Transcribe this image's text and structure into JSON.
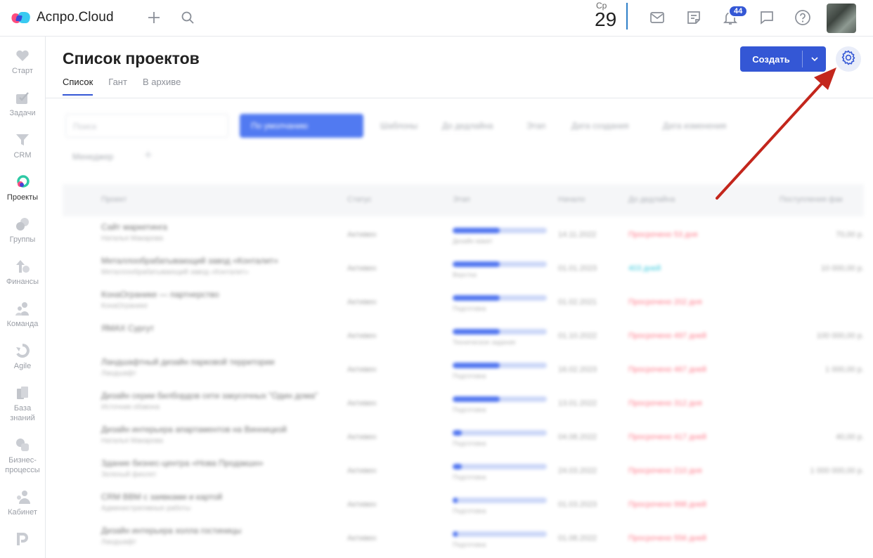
{
  "app": {
    "name": "Аспро.Cloud"
  },
  "date": {
    "weekday": "Ср",
    "day": "29"
  },
  "notifications": {
    "count": "44"
  },
  "sidebar": {
    "items": [
      {
        "label": "Старт"
      },
      {
        "label": "Задачи"
      },
      {
        "label": "CRM"
      },
      {
        "label": "Проекты"
      },
      {
        "label": "Группы"
      },
      {
        "label": "Финансы"
      },
      {
        "label": "Команда"
      },
      {
        "label": "Agile"
      },
      {
        "label": "База знаний"
      },
      {
        "label": "Бизнес-процессы"
      },
      {
        "label": "Кабинет"
      }
    ]
  },
  "page": {
    "title": "Список проектов",
    "tabs": [
      {
        "label": "Список"
      },
      {
        "label": "Гант"
      },
      {
        "label": "В архиве"
      }
    ],
    "create_label": "Создать"
  },
  "blurred": {
    "search_placeholder": "Поиск",
    "filter_label": "По умолчанию",
    "chips": [
      "Шаблоны",
      "До дедлайна",
      "Этап",
      "Дата создания",
      "Дата изменения",
      "Менеджер"
    ],
    "headers": [
      "Проект",
      "Статус",
      "Этап",
      "Начало",
      "До дедлайна",
      "Поступления фак"
    ],
    "rows": [
      {
        "name": "Сайт маркетинга",
        "sub": "Наталья Макарова",
        "status": "Активен",
        "progress": 0.5,
        "stage": "Дизайн макет",
        "date": "14.11.2022",
        "deadline": "Просрочено 53 дня",
        "late": true,
        "sum": "70,00 р."
      },
      {
        "name": "Металлообрабатывающий завод «Конталит»",
        "sub": "Металлообрабатывающий завод «Конталит»",
        "status": "Активен",
        "progress": 0.5,
        "stage": "Верстка",
        "date": "01.01.2023",
        "deadline": "403 дней",
        "late": false,
        "sum": "10 000,00 р."
      },
      {
        "name": "КонаОгранике — партнерство",
        "sub": "КонаОгранике",
        "status": "Активен",
        "progress": 0.5,
        "stage": "Подготовка",
        "date": "01.02.2021",
        "deadline": "Просрочено 202 дня",
        "late": true,
        "sum": ""
      },
      {
        "name": "ЯМАХ Сургут",
        "sub": "",
        "status": "Активен",
        "progress": 0.5,
        "stage": "Техническое задание",
        "date": "01.10.2022",
        "deadline": "Просрочено 497 дней",
        "late": true,
        "sum": "100 000,00 р."
      },
      {
        "name": "Ландшафтный дизайн парковой территории",
        "sub": "Ландшафт",
        "status": "Активен",
        "progress": 0.5,
        "stage": "Подготовка",
        "date": "16.02.2023",
        "deadline": "Просрочено 467 дней",
        "late": true,
        "sum": "1 000,00 р."
      },
      {
        "name": "Дизайн серии билбордов сети закусочных \"Один дома\"",
        "sub": "Источник обзвона",
        "status": "Активен",
        "progress": 0.5,
        "stage": "Подготовка",
        "date": "13.01.2022",
        "deadline": "Просрочено 312 дня",
        "late": true,
        "sum": ""
      },
      {
        "name": "Дизайн интерьера апартаментов на Винницкой",
        "sub": "Наталья Макарова",
        "status": "Активен",
        "progress": 0.1,
        "stage": "Подготовка",
        "date": "04.08.2022",
        "deadline": "Просрочено 417 дней",
        "late": true,
        "sum": "40,00 р."
      },
      {
        "name": "Здание бизнес-центра «Нова Продакшн»",
        "sub": "Зеленый фиолет",
        "status": "Активен",
        "progress": 0.1,
        "stage": "Подготовка",
        "date": "24.03.2022",
        "deadline": "Просрочено 210 дня",
        "late": true,
        "sum": "1 000 000,00 р."
      },
      {
        "name": "CRM ВВМ с заявками и картой",
        "sub": "Административные работы",
        "status": "Активен",
        "progress": 0.05,
        "stage": "Подготовка",
        "date": "01.03.2023",
        "deadline": "Просрочено 998 дней",
        "late": true,
        "sum": ""
      },
      {
        "name": "Дизайн интерьера холла гостиницы",
        "sub": "Ландшафт",
        "status": "Активен",
        "progress": 0.05,
        "stage": "Подготовка",
        "date": "01.08.2022",
        "deadline": "Просрочено 556 дней",
        "late": true,
        "sum": ""
      }
    ]
  },
  "colors": {
    "accent": "#3457d5",
    "arrow": "#c3261c",
    "overdue": "#ff6b7d",
    "ontime": "#22c3d8"
  }
}
